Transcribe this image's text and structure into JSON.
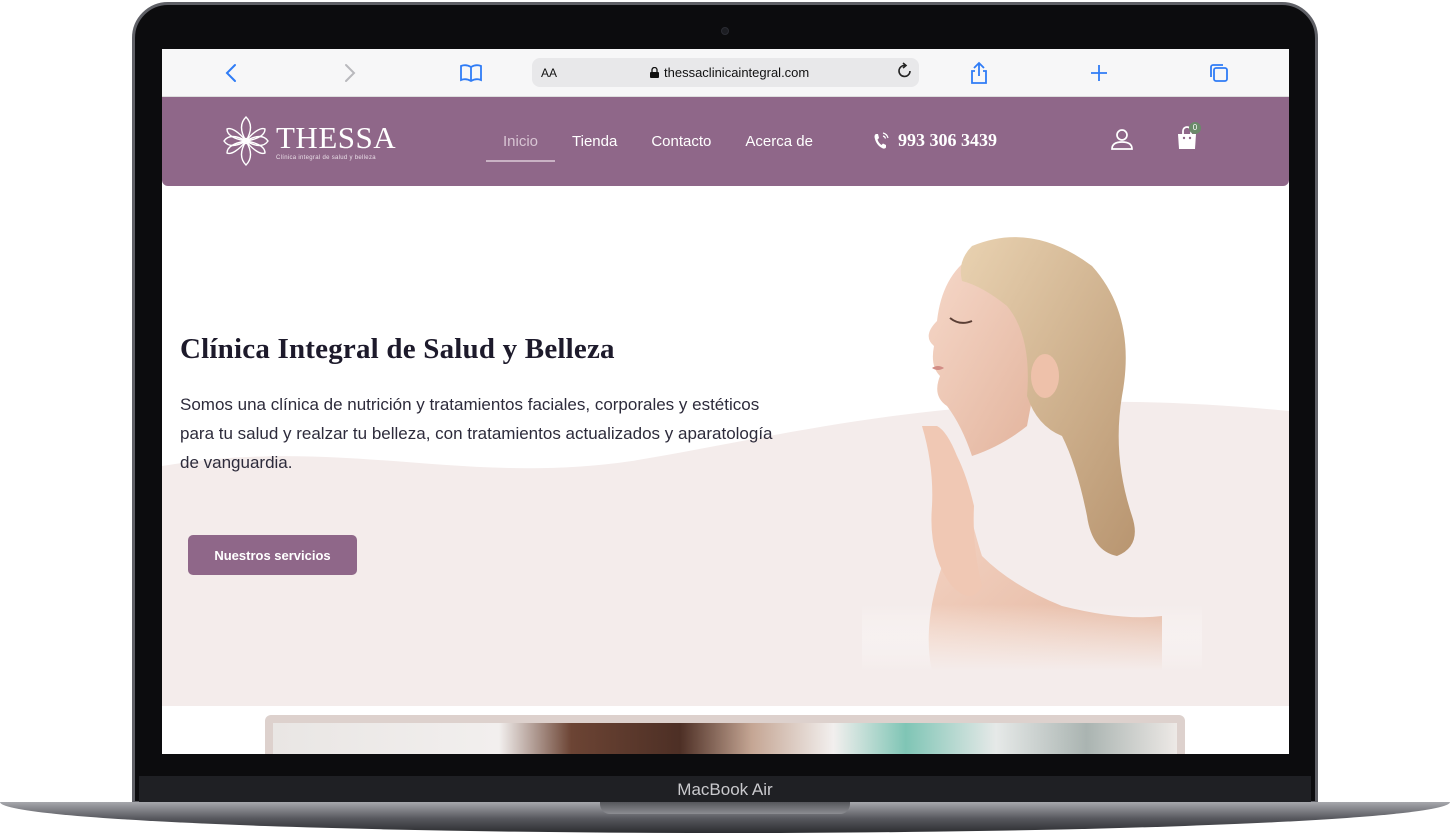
{
  "browser": {
    "url": "thessaclinicaintegral.com",
    "reader_label": "AA"
  },
  "site": {
    "logo_name": "THESSA",
    "logo_tagline": "Clínica integral de salud y belleza",
    "nav": [
      "Inicio",
      "Tienda",
      "Contacto",
      "Acerca de"
    ],
    "phone": "993 306 3439",
    "cart_count": "0"
  },
  "hero": {
    "title": "Clínica Integral de Salud y Belleza",
    "description": "Somos una clínica de nutrición y tratamientos faciales, corporales y estéticos  para tu salud y realzar tu belleza, con tratamientos actualizados y aparatología de vanguardia.",
    "button_label": "Nuestros servicios"
  },
  "device": {
    "label": "MacBook Air"
  },
  "colors": {
    "brand": "#8f6789",
    "hero_wave": "#f4eceb",
    "link": "#2f7cf6"
  }
}
